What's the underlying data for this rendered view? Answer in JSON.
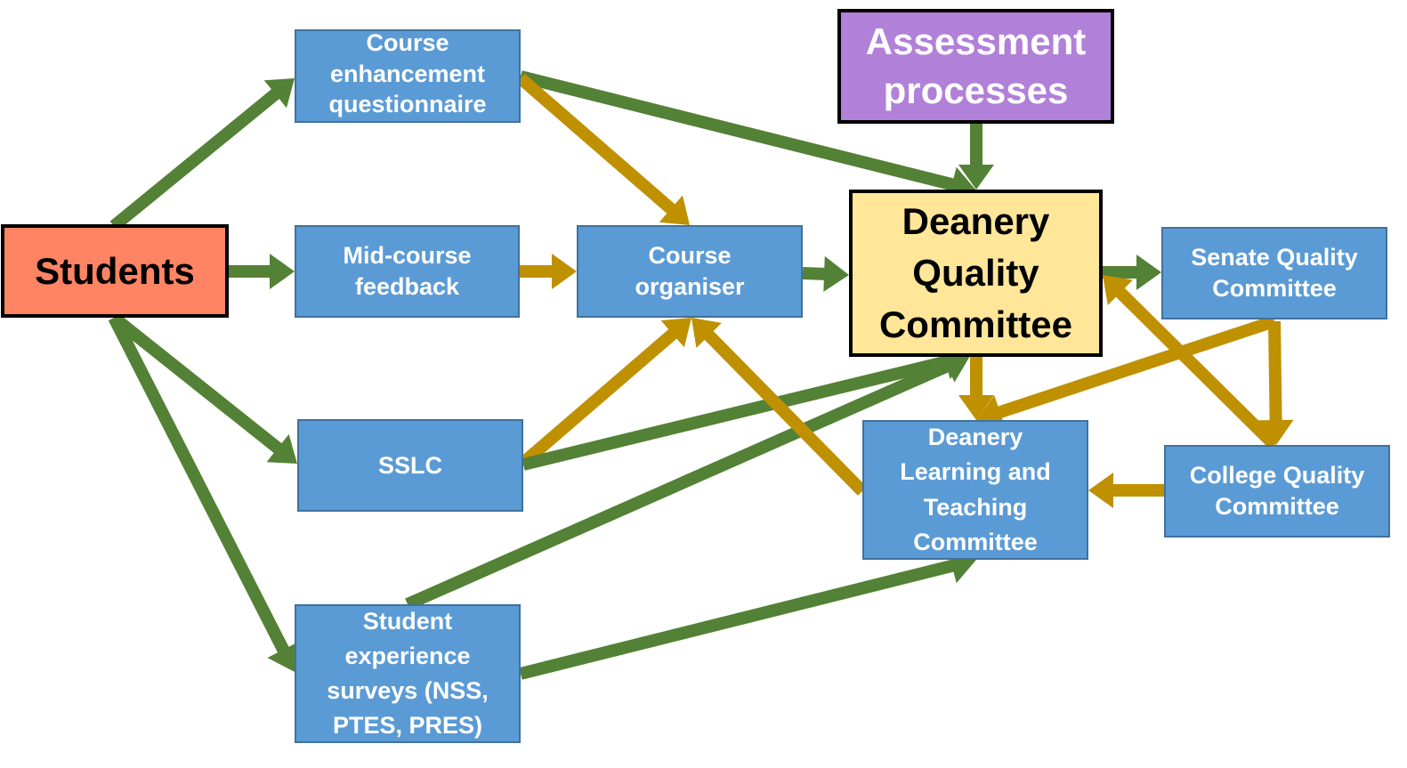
{
  "colors": {
    "green_arrow": "#538135",
    "gold_arrow": "#bf9000",
    "box_blue": "#5b9bd5",
    "students": "#ff8464",
    "assessment": "#b180d8",
    "deanery_quality": "#ffe699"
  },
  "nodes": {
    "students": {
      "label": "Students"
    },
    "ceq": {
      "label": "Course\nenhancement\nquestionnaire"
    },
    "mcf": {
      "label": "Mid-course\nfeedback"
    },
    "sslc": {
      "label": "SSLC"
    },
    "ses": {
      "label": "Student\nexperience\nsurveys (NSS,\nPTES, PRES)"
    },
    "co": {
      "label": "Course\norganiser"
    },
    "assess": {
      "label": "Assessment\nprocesses"
    },
    "dqc": {
      "label": "Deanery\nQuality\nCommittee"
    },
    "dltc": {
      "label": "Deanery\nLearning and\nTeaching\nCommittee"
    },
    "sqc": {
      "label": "Senate Quality\nCommittee"
    },
    "cqc": {
      "label": "College Quality\nCommittee"
    }
  },
  "edges": [
    {
      "from": "students",
      "to": "ceq",
      "color": "green"
    },
    {
      "from": "students",
      "to": "mcf",
      "color": "green"
    },
    {
      "from": "students",
      "to": "sslc",
      "color": "green"
    },
    {
      "from": "students",
      "to": "ses",
      "color": "green"
    },
    {
      "from": "ceq",
      "to": "dqc",
      "color": "green"
    },
    {
      "from": "ceq",
      "to": "co",
      "color": "gold"
    },
    {
      "from": "mcf",
      "to": "co",
      "color": "gold"
    },
    {
      "from": "sslc",
      "to": "co",
      "color": "gold"
    },
    {
      "from": "sslc",
      "to": "dqc",
      "color": "green"
    },
    {
      "from": "ses",
      "to": "dqc",
      "color": "green"
    },
    {
      "from": "ses",
      "to": "dltc",
      "color": "green"
    },
    {
      "from": "co",
      "to": "dqc",
      "color": "green"
    },
    {
      "from": "assess",
      "to": "dqc",
      "color": "green"
    },
    {
      "from": "dqc",
      "to": "sqc",
      "color": "green"
    },
    {
      "from": "dqc",
      "to": "dltc",
      "color": "gold"
    },
    {
      "from": "dltc",
      "to": "co",
      "color": "gold"
    },
    {
      "from": "sqc",
      "to": "dltc",
      "color": "gold"
    },
    {
      "from": "sqc",
      "to": "cqc",
      "color": "gold"
    },
    {
      "from": "cqc",
      "to": "dqc",
      "color": "gold"
    },
    {
      "from": "cqc",
      "to": "dltc",
      "color": "gold"
    }
  ]
}
